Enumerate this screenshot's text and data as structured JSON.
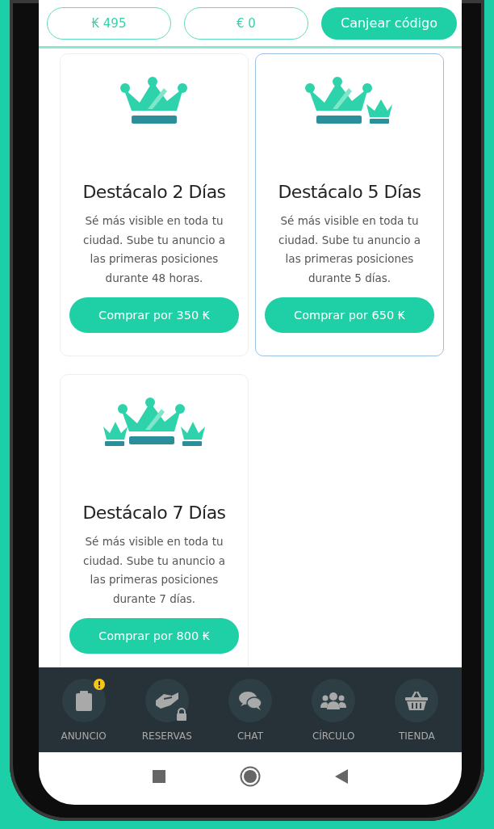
{
  "balances": [
    {
      "symbol": "₭",
      "amount": "495"
    },
    {
      "symbol": "€",
      "amount": "0"
    }
  ],
  "redeem_button": "Canjear código",
  "offers": [
    {
      "kind": "single",
      "title": "Destácalo 2 Días",
      "description": "Sé más visible en toda tu ciudad. Sube tu anuncio a las primeras posiciones durante 48 horas.",
      "button": "Comprar por 350 ₭",
      "selected": false
    },
    {
      "kind": "double",
      "title": "Destácalo 5 Días",
      "description": "Sé más visible en toda tu ciudad. Sube tu anuncio a las primeras posiciones durante 5 días.",
      "button": "Comprar por 650 ₭",
      "selected": true
    },
    {
      "kind": "triple",
      "title": "Destácalo 7 Días",
      "description": "Sé más visible en toda tu ciudad. Sube tu anuncio a las primeras posiciones durante 7 días.",
      "button": "Comprar por 800 ₭",
      "selected": false
    }
  ],
  "nav": [
    {
      "kind": "clipboard",
      "label": "ANUNCIO",
      "alert": true,
      "locked": false
    },
    {
      "kind": "handshake",
      "label": "RESERVAS",
      "alert": false,
      "locked": true
    },
    {
      "kind": "chat",
      "label": "CHAT",
      "alert": false,
      "locked": false
    },
    {
      "kind": "group",
      "label": "CÍRCULO",
      "alert": false,
      "locked": false
    },
    {
      "kind": "basket",
      "label": "TIENDA",
      "alert": false,
      "locked": false
    }
  ]
}
